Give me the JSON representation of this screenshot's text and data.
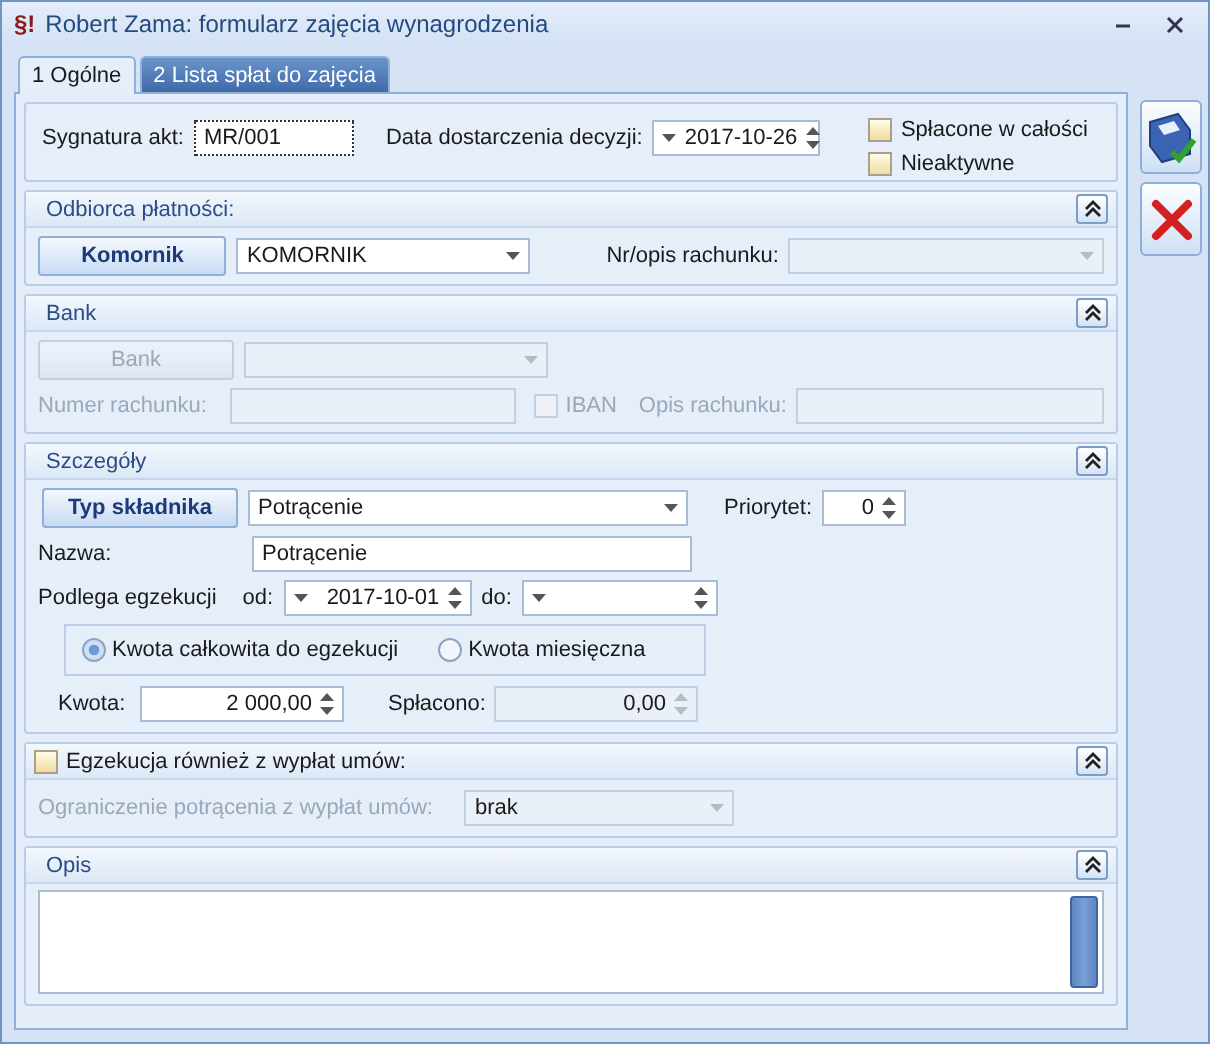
{
  "window": {
    "icon": "§!",
    "title": "Robert Zama: formularz zajęcia wynagrodzenia"
  },
  "tabs": [
    {
      "label": "1 Ogólne",
      "selected": true
    },
    {
      "label": "2 Lista spłat do zajęcia",
      "selected": false
    }
  ],
  "header": {
    "signature_label": "Sygnatura akt:",
    "signature": "MR/001",
    "date_label": "Data dostarczenia decyzji:",
    "date": "2017-10-26",
    "checkboxes": [
      {
        "label": "Spłacone w całości",
        "checked": false
      },
      {
        "label": "Nieaktywne",
        "checked": false
      }
    ]
  },
  "payee": {
    "title": "Odbiorca płatności:",
    "button": "Komornik",
    "select": "KOMORNIK",
    "account_label": "Nr/opis rachunku:"
  },
  "bank": {
    "title": "Bank",
    "disabled": true,
    "button": "Bank",
    "account_label": "Numer rachunku:",
    "iban_label": "IBAN",
    "iban_checked": false,
    "description_label": "Opis rachunku:"
  },
  "details": {
    "title": "Szczegóły",
    "type_button": "Typ składnika",
    "type_value": "Potrącenie",
    "priority_label": "Priorytet:",
    "priority": "0",
    "name_label": "Nazwa:",
    "name": "Potrącenie",
    "enforcement_label": "Podlega egzekucji",
    "from_label": "od:",
    "from": "2017-10-01",
    "to_label": "do:",
    "options": [
      {
        "label": "Kwota całkowita do egzekucji",
        "selected": true
      },
      {
        "label": "Kwota miesięczna",
        "selected": false
      }
    ],
    "amount_label": "Kwota:",
    "amount": "2 000,00",
    "paid_label": "Spłacono:",
    "paid": "0,00"
  },
  "contracts": {
    "title": "Egzekucja również z wypłat umów:",
    "checked": false,
    "limit_label": "Ograniczenie potrącenia z wypłat umów:",
    "limit": "brak"
  },
  "notes": {
    "title": "Opis"
  }
}
